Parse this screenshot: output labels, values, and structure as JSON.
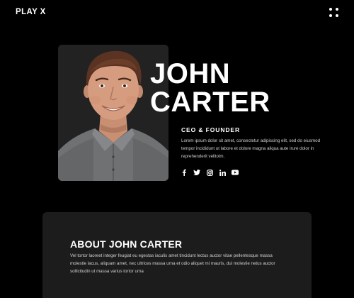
{
  "header": {
    "logo": "PLAY X",
    "menu_icon": "dots-grid-icon"
  },
  "hero": {
    "name_line1": "JOHN",
    "name_line2": "CARTER",
    "role": "CEO & FOUNDER",
    "bio": "Lorem ipsum dolor sit amet, consectetur adipiscing elit, sed do eiusmod tempor incididunt ut labore et dolore magna aliqua aute irure dolor in reprehenderit velitolm.",
    "socials": [
      "facebook-icon",
      "twitter-icon",
      "instagram-icon",
      "linkedin-icon",
      "youtube-icon"
    ]
  },
  "about": {
    "title": "ABOUT JOHN CARTER",
    "text": "Vel tortor laoreet integer feugiat eu egestas iaculis amet tincidunt lectus auctor vitae pellentesque massa molestie lacus, aliquam amet, nec ultrices massa urna et odio aliquet mi mauris, dui molestie netus auctor sollicitudin ut massa varius tortor urna"
  },
  "colors": {
    "background": "#000000",
    "card": "#1c1c1c",
    "text": "#ffffff"
  }
}
